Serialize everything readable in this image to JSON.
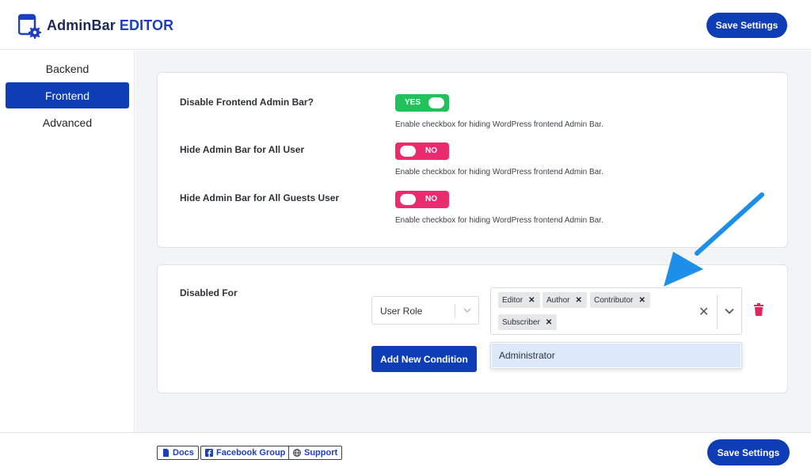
{
  "header": {
    "brand_part1": "AdminBar",
    "brand_part2": "EDITOR",
    "save_label": "Save Settings"
  },
  "sidebar": {
    "items": [
      {
        "label": "Backend",
        "active": false
      },
      {
        "label": "Frontend",
        "active": true
      },
      {
        "label": "Advanced",
        "active": false
      }
    ]
  },
  "settings": {
    "rows": [
      {
        "label": "Disable Frontend Admin Bar?",
        "toggle": "YES",
        "state": "on",
        "help": "Enable checkbox for hiding WordPress frontend Admin Bar."
      },
      {
        "label": "Hide Admin Bar for All User",
        "toggle": "NO",
        "state": "off",
        "help": "Enable checkbox for hiding WordPress frontend Admin Bar."
      },
      {
        "label": "Hide Admin Bar for All Guests User",
        "toggle": "NO",
        "state": "off",
        "help": "Enable checkbox for hiding WordPress frontend Admin Bar."
      }
    ]
  },
  "conditions": {
    "label": "Disabled For",
    "type_select": "User Role",
    "tags": [
      "Editor",
      "Author",
      "Contributor",
      "Subscriber"
    ],
    "dropdown_option": "Administrator",
    "add_label": "Add New Condition"
  },
  "footer": {
    "links": [
      "Docs",
      "Facebook Group",
      "Support"
    ],
    "save_label": "Save Settings"
  },
  "colors": {
    "primary": "#0f3db5",
    "toggle_on": "#1fc35a",
    "toggle_off": "#ec2a6e",
    "arrow": "#1c8fe8",
    "trash": "#e0245e"
  }
}
